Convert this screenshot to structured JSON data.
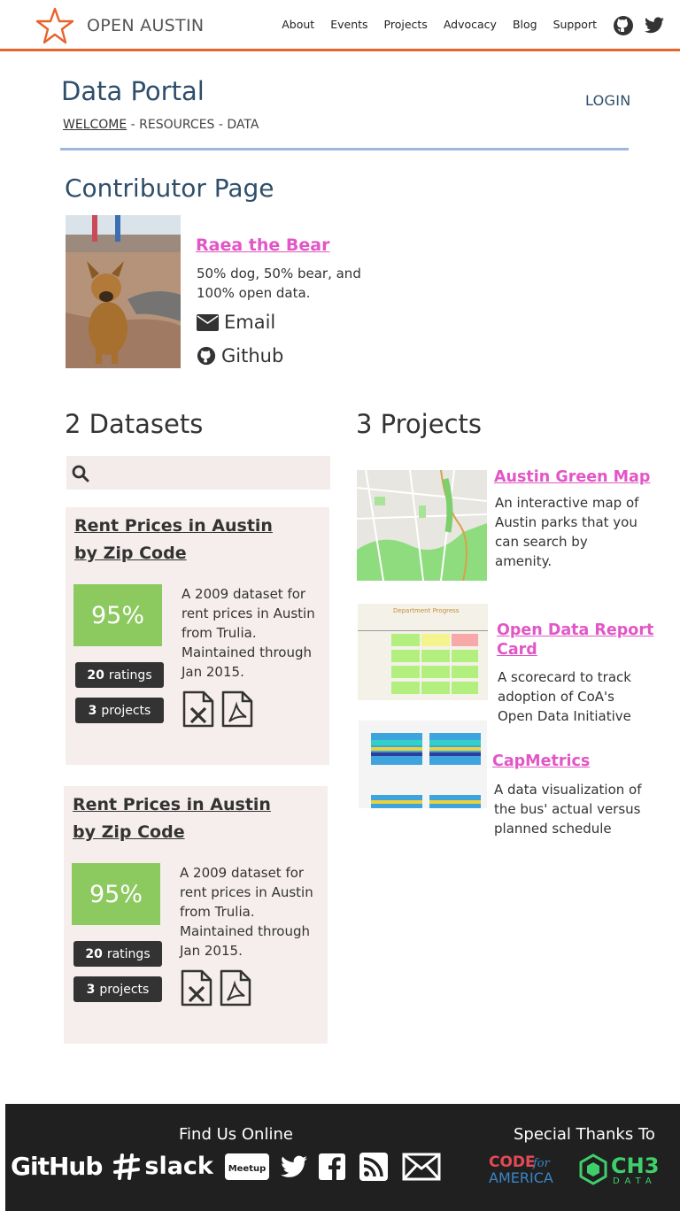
{
  "brand": {
    "name": "OPEN AUSTIN"
  },
  "nav": {
    "items": [
      "About",
      "Events",
      "Projects",
      "Advocacy",
      "Blog",
      "Support"
    ]
  },
  "header": {
    "title": "Data Portal",
    "login": "LOGIN",
    "breadcrumb": {
      "current": "WELCOME",
      "rest": " - RESOURCES - DATA"
    }
  },
  "page_title": "Contributor Page",
  "profile": {
    "name": "Raea the Bear",
    "bio": "50% dog, 50% bear, and 100% open data.",
    "email_label": "Email",
    "github_label": "Github"
  },
  "datasets": {
    "heading": "2 Datasets",
    "items": [
      {
        "title": "Rent Prices in Austin by Zip Code",
        "score": "95%",
        "ratings_count": "20",
        "ratings_label": "ratings",
        "projects_count": "3",
        "projects_label": "projects",
        "description": "A 2009 dataset for rent prices in Austin from Trulia. Maintained through Jan 2015."
      },
      {
        "title": "Rent Prices in Austin by Zip Code",
        "score": "95%",
        "ratings_count": "20",
        "ratings_label": "ratings",
        "projects_count": "3",
        "projects_label": "projects",
        "description": "A 2009 dataset for rent prices in Austin from Trulia. Maintained through Jan 2015."
      }
    ]
  },
  "projects": {
    "heading": "3 Projects",
    "items": [
      {
        "title": "Austin Green Map",
        "description": "An interactive map of Austin parks that you can search by amenity."
      },
      {
        "title": "Open Data Report Card",
        "description": "A scorecard to track adoption of CoA's Open Data Initiative",
        "thumb_heading": "Department Progress"
      },
      {
        "title": "CapMetrics",
        "description": "A data visualization of the bus' actual versus planned schedule"
      }
    ]
  },
  "footer": {
    "find_us": "Find Us Online",
    "thanks": "Special Thanks To",
    "github_word": "GitHub",
    "slack_word": "slack",
    "meetup_word": "Meetup",
    "cfa_line1": "CODE",
    "cfa_for": "for",
    "cfa_line2": "AMERICA",
    "ch3_line1": "CH3",
    "ch3_line2": "DATA"
  },
  "colors": {
    "accent": "#e8622c",
    "link_pink": "#e256c5",
    "title_blue": "#2f4e6b",
    "score_green": "#8cc95f",
    "card_bg": "#f6eeec"
  }
}
